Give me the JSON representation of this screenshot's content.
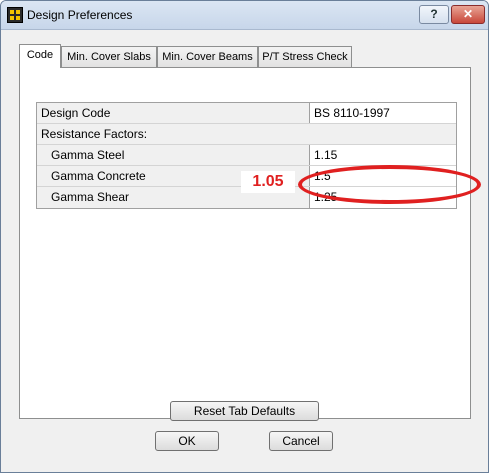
{
  "window": {
    "title": "Design Preferences",
    "help_label": "?",
    "close_label": "✕"
  },
  "tabs": [
    {
      "label": "Code"
    },
    {
      "label": "Min. Cover Slabs"
    },
    {
      "label": "Min. Cover Beams"
    },
    {
      "label": "P/T Stress Check"
    }
  ],
  "grid": {
    "rows": [
      {
        "label": "Design Code",
        "value": "BS 8110-1997"
      },
      {
        "label": "Resistance Factors:",
        "value": ""
      },
      {
        "label": "Gamma Steel",
        "value": "1.15"
      },
      {
        "label": "Gamma Concrete",
        "value": "1.5"
      },
      {
        "label": "Gamma Shear",
        "value": "1.25"
      }
    ]
  },
  "annotation": {
    "text": "1.05",
    "color": "#e02020"
  },
  "buttons": {
    "reset": "Reset Tab Defaults",
    "ok": "OK",
    "cancel": "Cancel"
  }
}
